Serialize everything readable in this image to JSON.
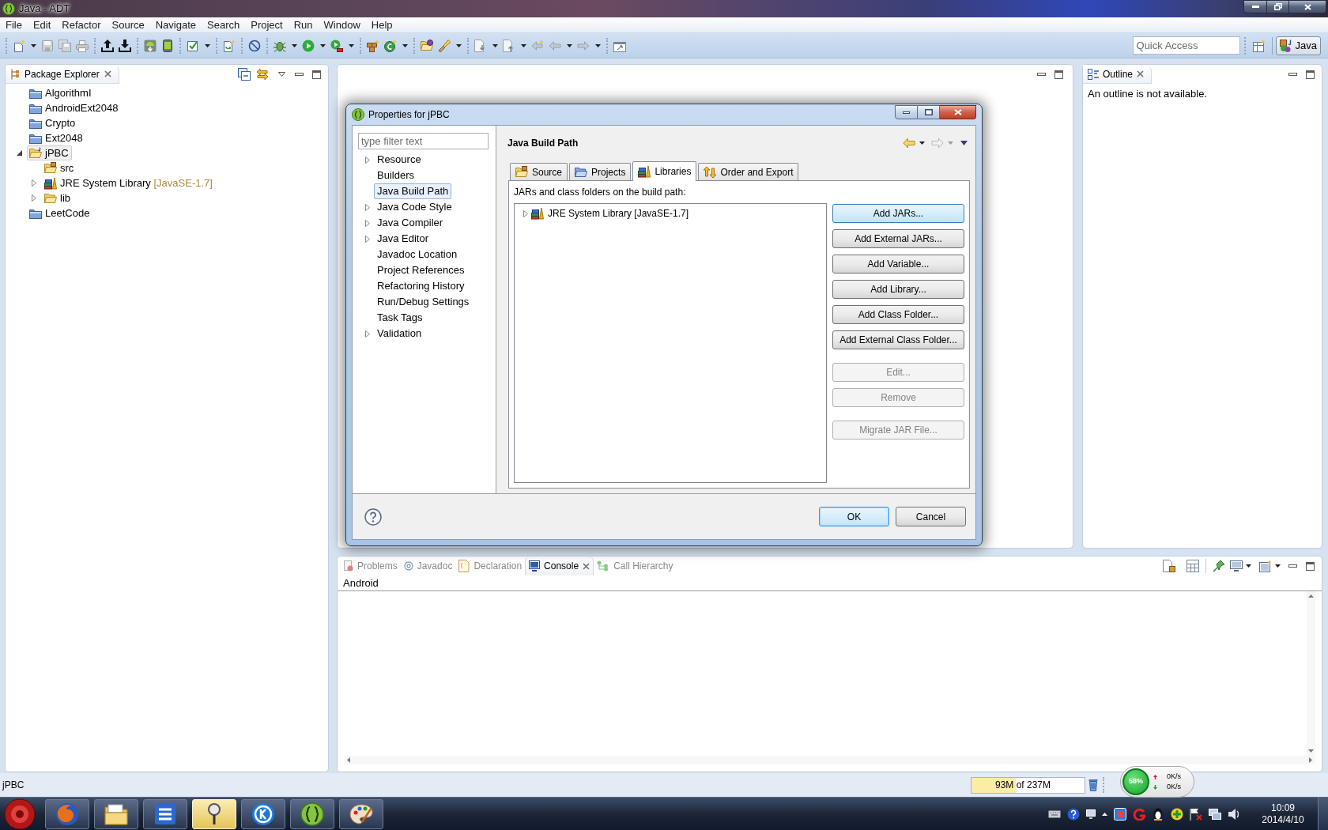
{
  "window": {
    "title": "Java - ADT"
  },
  "menu_bar": [
    "File",
    "Edit",
    "Refactor",
    "Source",
    "Navigate",
    "Search",
    "Project",
    "Run",
    "Window",
    "Help"
  ],
  "toolbar": {
    "quick_access": {
      "placeholder": "Quick Access"
    },
    "perspectives": [
      {
        "label": "Java",
        "selected": true
      }
    ]
  },
  "package_explorer": {
    "title": "Package Explorer",
    "items": [
      {
        "label": "AlgorithmI",
        "kind": "closed-project",
        "selected": false
      },
      {
        "label": "AndroidExt2048",
        "kind": "closed-project",
        "selected": false
      },
      {
        "label": "Crypto",
        "kind": "closed-project",
        "selected": false
      },
      {
        "label": "Ext2048",
        "kind": "closed-project",
        "selected": false
      },
      {
        "label": "jPBC",
        "kind": "java-project",
        "selected": true,
        "expanded": true,
        "children": [
          {
            "label": "src",
            "kind": "source-folder",
            "selected": false
          },
          {
            "label": "JRE System Library",
            "decoration": "[JavaSE-1.7]",
            "kind": "library",
            "selected": false,
            "expanded": false
          },
          {
            "label": "lib",
            "kind": "folder",
            "selected": false,
            "expanded": false
          }
        ]
      },
      {
        "label": "LeetCode",
        "kind": "closed-project",
        "selected": false
      }
    ]
  },
  "outline": {
    "title": "Outline",
    "message": "An outline is not available."
  },
  "dialog": {
    "title": "Properties for jPBC",
    "filter": {
      "placeholder": "type filter text"
    },
    "nav": [
      {
        "label": "Resource",
        "expanded": false,
        "selected": false
      },
      {
        "label": "Builders",
        "selected": false
      },
      {
        "label": "Java Build Path",
        "selected": true
      },
      {
        "label": "Java Code Style",
        "expanded": false,
        "selected": false
      },
      {
        "label": "Java Compiler",
        "expanded": false,
        "selected": false
      },
      {
        "label": "Java Editor",
        "expanded": false,
        "selected": false
      },
      {
        "label": "Javadoc Location",
        "selected": false
      },
      {
        "label": "Project References",
        "selected": false
      },
      {
        "label": "Refactoring History",
        "selected": false
      },
      {
        "label": "Run/Debug Settings",
        "selected": false
      },
      {
        "label": "Task Tags",
        "selected": false
      },
      {
        "label": "Validation",
        "expanded": false,
        "selected": false
      }
    ],
    "page_title": "Java Build Path",
    "tabs": [
      {
        "label": "Source",
        "kind": "source",
        "selected": false
      },
      {
        "label": "Projects",
        "kind": "projects",
        "selected": false
      },
      {
        "label": "Libraries",
        "kind": "libraries",
        "selected": true
      },
      {
        "label": "Order and Export",
        "kind": "order",
        "selected": false
      }
    ],
    "list_label": "JARs and class folders on the build path:",
    "entries": [
      {
        "label": "JRE System Library [JavaSE-1.7]",
        "expanded": false
      }
    ],
    "button_groups": [
      {
        "buttons": [
          {
            "label": "Add JARs...",
            "disabled": false,
            "hovered": true
          },
          {
            "label": "Add External JARs...",
            "disabled": false,
            "hovered": false
          },
          {
            "label": "Add Variable...",
            "disabled": false,
            "hovered": false
          },
          {
            "label": "Add Library...",
            "disabled": false,
            "hovered": false
          },
          {
            "label": "Add Class Folder...",
            "disabled": false,
            "hovered": false
          },
          {
            "label": "Add External Class Folder...",
            "disabled": false,
            "hovered": false
          }
        ]
      },
      {
        "buttons": [
          {
            "label": "Edit...",
            "disabled": true,
            "hovered": false
          },
          {
            "label": "Remove",
            "disabled": true,
            "hovered": false
          }
        ]
      },
      {
        "buttons": [
          {
            "label": "Migrate JAR File...",
            "disabled": true,
            "hovered": false
          }
        ]
      }
    ],
    "buttons": [
      {
        "label": "OK",
        "default": true
      },
      {
        "label": "Cancel",
        "default": false
      }
    ]
  },
  "console": {
    "tabs": [
      {
        "label": "Problems",
        "kind": "problems",
        "selected": false
      },
      {
        "label": "Javadoc",
        "kind": "javadoc",
        "selected": false
      },
      {
        "label": "Declaration",
        "kind": "declaration",
        "selected": false
      },
      {
        "label": "Console",
        "kind": "console",
        "selected": true
      },
      {
        "label": "Call Hierarchy",
        "kind": "call-hierarchy",
        "selected": false
      }
    ],
    "name": "Android"
  },
  "status_bar": {
    "text": "jPBC",
    "memory": {
      "text": "93M of 237M",
      "level": 0.39
    }
  },
  "network_widget": {
    "percent": "58%",
    "upload": "0K/s",
    "download": "0K/s"
  },
  "taskbar": {
    "apps": [
      {
        "kind": "firefox",
        "selected": false
      },
      {
        "kind": "file-explorer",
        "selected": false
      },
      {
        "kind": "list-app",
        "selected": false
      },
      {
        "kind": "tool-app",
        "selected": true
      },
      {
        "kind": "k-app",
        "selected": false
      },
      {
        "kind": "adt",
        "selected": false
      },
      {
        "kind": "paint",
        "selected": false
      }
    ],
    "clock": {
      "time": "10:09",
      "date": "2014/4/10"
    }
  }
}
